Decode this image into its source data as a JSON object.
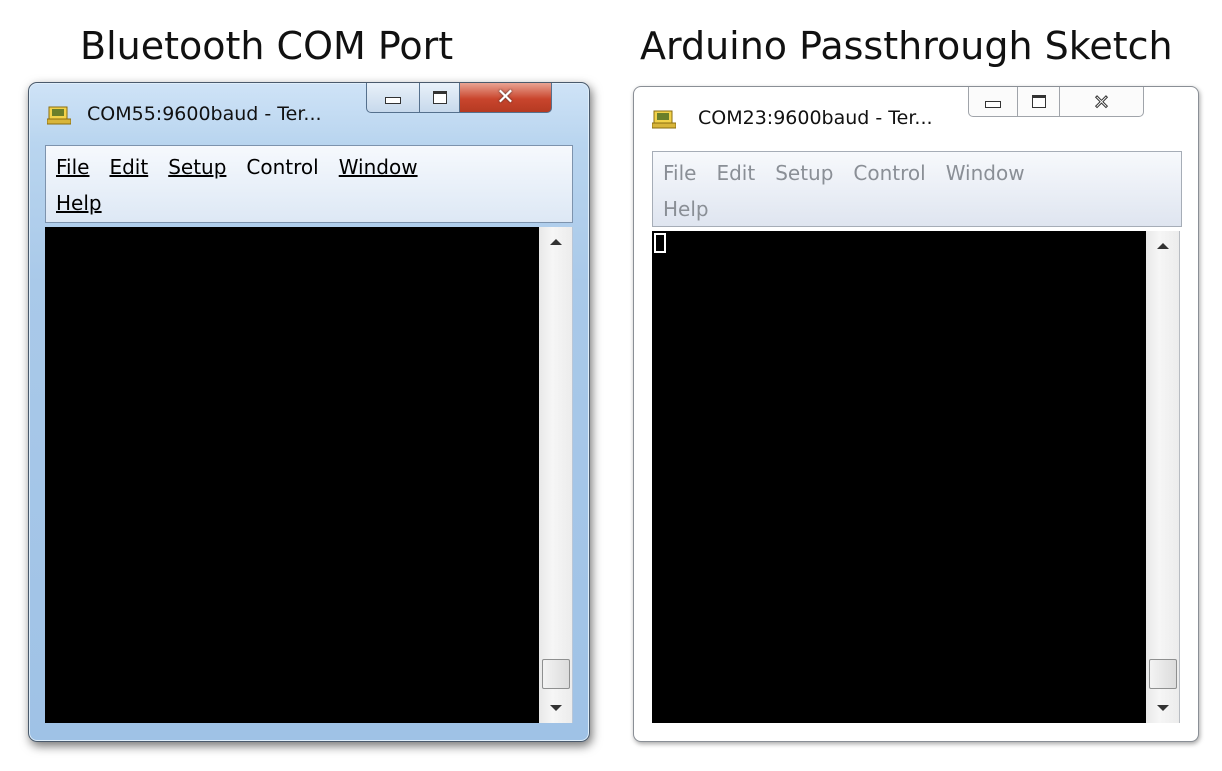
{
  "captions": {
    "left": "Bluetooth COM Port",
    "right": "Arduino Passthrough Sketch"
  },
  "windows": [
    {
      "title": "COM55:9600baud - Ter...",
      "state": "active",
      "menu": {
        "row1": [
          "File",
          "Edit",
          "Setup",
          "Control",
          "Window"
        ],
        "row2": [
          "Help"
        ]
      },
      "icons": {
        "app": "teraterm-app-icon",
        "minimize": "minimize-icon",
        "maximize": "maximize-icon",
        "close": "close-icon"
      },
      "colors": {
        "close_button": "#c9452d",
        "frame": "#a9c9e9"
      }
    },
    {
      "title": "COM23:9600baud - Ter...",
      "state": "inactive",
      "menu": {
        "row1": [
          "File",
          "Edit",
          "Setup",
          "Control",
          "Window"
        ],
        "row2": [
          "Help"
        ]
      },
      "icons": {
        "app": "teraterm-app-icon",
        "minimize": "minimize-icon",
        "maximize": "maximize-icon",
        "close": "close-icon"
      },
      "colors": {
        "frame": "#ffffff",
        "menu_text": "#8a8f96"
      }
    }
  ],
  "terminal": {
    "background": "#000000",
    "cursor_color": "#ffffff"
  },
  "glyphs": {
    "close": "✕"
  }
}
